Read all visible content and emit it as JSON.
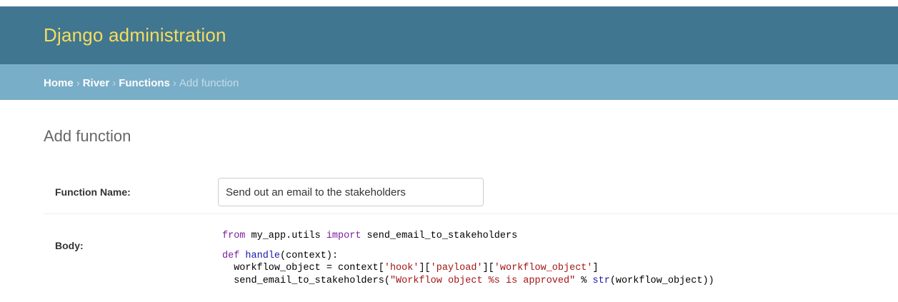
{
  "header": {
    "brand": "Django administration"
  },
  "breadcrumbs": {
    "home": "Home",
    "app": "River",
    "model": "Functions",
    "current": "Add function",
    "separator": "›"
  },
  "page": {
    "title": "Add function"
  },
  "form": {
    "name_label": "Function Name:",
    "name_value": "Send out an email to the stakeholders",
    "body_label": "Body:",
    "body_code": {
      "line1": {
        "kw1": "from",
        "mod": " my_app.utils ",
        "kw2": "import",
        "rest": " send_email_to_stakeholders"
      },
      "line2": {
        "kw": "def",
        "sp": " ",
        "fn": "handle",
        "rest": "(context):"
      },
      "line3": {
        "a": "  workflow_object = context[",
        "s1": "'hook'",
        "b": "][",
        "s2": "'payload'",
        "c": "][",
        "s3": "'workflow_object'",
        "d": "]"
      },
      "line4": {
        "a": "  send_email_to_stakeholders(",
        "s1": "\"Workflow object %s is approved\"",
        "b": " % ",
        "bi": "str",
        "c": "(workflow_object))"
      }
    }
  },
  "colors": {
    "header_bg": "#417690",
    "brand": "#f5dd5d",
    "breadcrumbs_bg": "#79aec8",
    "keyword": "#7a1fa2",
    "string": "#a31515",
    "function": "#1a1aa6"
  }
}
